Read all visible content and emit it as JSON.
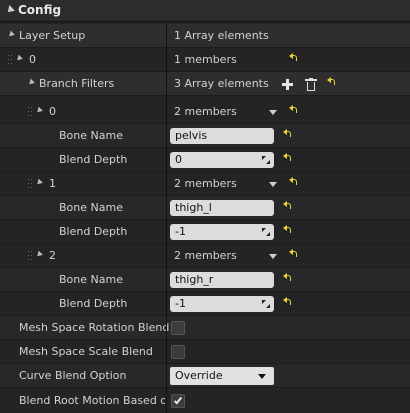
{
  "section": {
    "title": "Config"
  },
  "rows": {
    "layer_setup": {
      "label": "Layer Setup",
      "value": "1 Array elements"
    },
    "layer_0": {
      "label": "0",
      "value": "1 members"
    },
    "branch_filters": {
      "label": "Branch Filters",
      "value": "3 Array elements"
    },
    "bf0": {
      "label": "0",
      "value": "2 members"
    },
    "bf0_bone": {
      "label": "Bone Name",
      "value": "pelvis"
    },
    "bf0_depth": {
      "label": "Blend Depth",
      "value": "0"
    },
    "bf1": {
      "label": "1",
      "value": "2 members"
    },
    "bf1_bone": {
      "label": "Bone Name",
      "value": "thigh_l"
    },
    "bf1_depth": {
      "label": "Blend Depth",
      "value": "-1"
    },
    "bf2": {
      "label": "2",
      "value": "2 members"
    },
    "bf2_bone": {
      "label": "Bone Name",
      "value": "thigh_r"
    },
    "bf2_depth": {
      "label": "Blend Depth",
      "value": "-1"
    },
    "mesh_rot": {
      "label": "Mesh Space Rotation Blend",
      "checked": false
    },
    "mesh_scale": {
      "label": "Mesh Space Scale Blend",
      "checked": false
    },
    "curve_blend": {
      "label": "Curve Blend Option",
      "value": "Override"
    },
    "root_motion": {
      "label": "Blend Root Motion Based on Root Bone",
      "checked": true
    }
  },
  "icons": {
    "add": "plus-icon",
    "delete": "trash-icon",
    "reset": "reset-to-default-arrow-icon"
  },
  "colors": {
    "reset_arrow": "#e4d23a"
  }
}
